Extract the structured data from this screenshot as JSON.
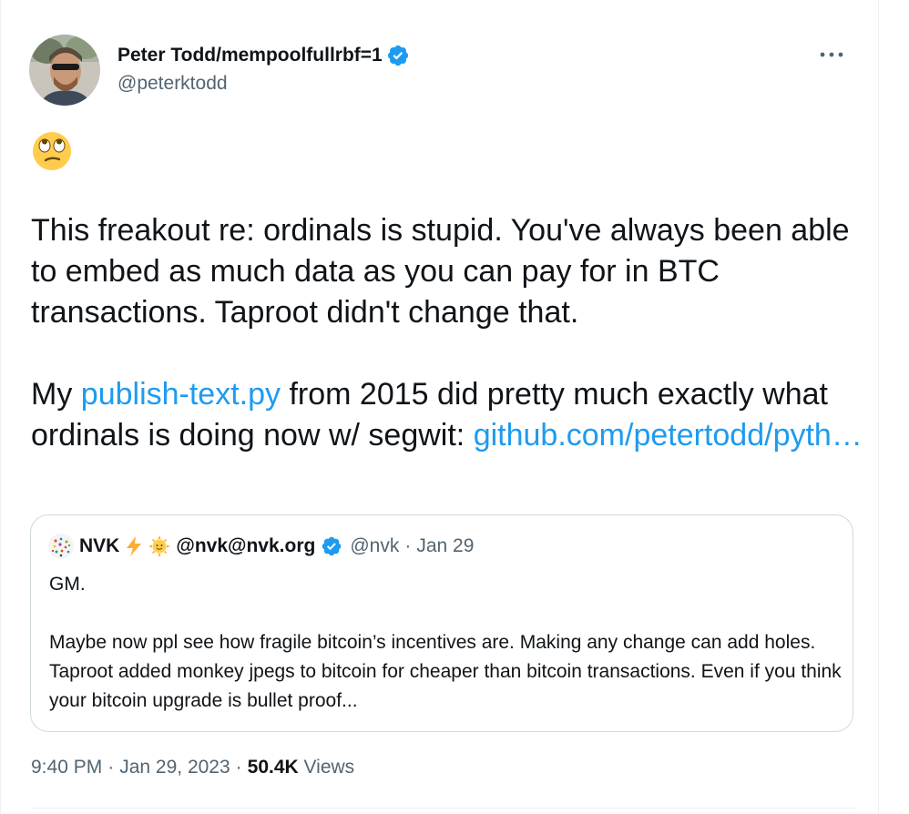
{
  "author": {
    "name": "Peter Todd/mempoolfullrbf=1",
    "handle": "@peterktodd"
  },
  "tweet": {
    "emoji": "face-with-rolling-eyes",
    "paragraph1": "This freakout re: ordinals is stupid. You've always been able to embed as much data as you can pay for in BTC transactions. Taproot didn't change that.",
    "p2_prefix": "My ",
    "p2_link": "publish-text.py",
    "p2_middle": " from 2015 did pretty much exactly what ordinals is doing now w/ segwit: ",
    "p2_url": "github.com/petertodd/pyth…"
  },
  "quote": {
    "name": "NVK",
    "emoji1": "high-voltage",
    "emoji2": "sun-with-face",
    "display2": "@nvk@nvk.org",
    "handle": "@nvk",
    "dot": "·",
    "date": "Jan 29",
    "line1": "GM.",
    "body": "Maybe now ppl see how fragile bitcoin’s incentives are. Making any change can add holes. Taproot added monkey jpegs to bitcoin for cheaper than bitcoin transactions. Even if you think your bitcoin upgrade is bullet proof..."
  },
  "meta": {
    "time": "9:40 PM",
    "sep1": "·",
    "date": "Jan 29, 2023",
    "sep2": "·",
    "views_count": "50.4K",
    "views_label": "Views"
  },
  "colors": {
    "link": "#1d9bf0",
    "verified": "#1d9bf0",
    "secondary_text": "#536471",
    "primary_text": "#0f1419"
  }
}
